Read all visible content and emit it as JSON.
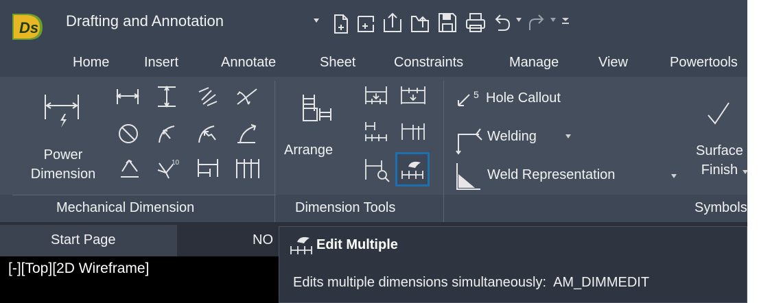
{
  "title_bar": {
    "logo_text": "Ds",
    "workspace": "Drafting and Annotation",
    "quick_access": [
      "new-icon",
      "new-from-template-icon",
      "open-icon",
      "open-cloud-icon",
      "save-icon",
      "print-icon",
      "undo-icon",
      "redo-icon",
      "customize-icon"
    ]
  },
  "ribbon_tabs": [
    "Home",
    "Insert",
    "Annotate",
    "Sheet",
    "Constraints",
    "Manage",
    "View",
    "Powertools"
  ],
  "panels": {
    "mechanical_dimension": {
      "title": "Mechanical Dimension",
      "power_dimension": "Power\nDimension"
    },
    "dimension_tools": {
      "title": "Dimension Tools",
      "arrange": "Arrange"
    },
    "symbols": {
      "title": "Symbols",
      "hole_callout": "Hole Callout",
      "hole_callout_icon_label": "5",
      "welding": "Welding",
      "weld_representation": "Weld Representation",
      "surface_finish": "Surface\nFinish"
    }
  },
  "document_tabs": [
    "Start Page",
    "NO"
  ],
  "viewport_label": "[-][Top][2D Wireframe]",
  "tooltip": {
    "title": "Edit Multiple",
    "description": "Edits multiple dimensions simultaneously:  AM_DIMMEDIT"
  },
  "colors": {
    "ribbon_bg": "#454e5d",
    "title_bg": "#3b4453",
    "highlight": "#1e6fb0",
    "tooltip_bg": "#2f3540"
  }
}
